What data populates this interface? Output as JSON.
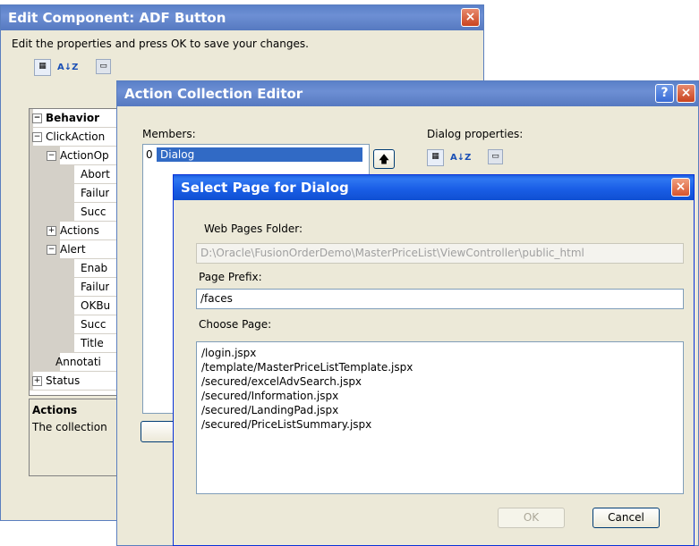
{
  "edit_component": {
    "title": "Edit Component: ADF Button",
    "instruction": "Edit the properties and press OK to save your changes.",
    "grid_rows": [
      {
        "label": "Behavior",
        "sign": "⊟",
        "indent": 0,
        "bold": true
      },
      {
        "label": "ClickAction",
        "sign": "⊟",
        "indent": 0,
        "bold": false
      },
      {
        "label": "ActionOp",
        "sign": "⊟",
        "indent": 1,
        "bold": false
      },
      {
        "label": "Abort",
        "sign": "",
        "indent": 2,
        "bold": false
      },
      {
        "label": "Failur",
        "sign": "",
        "indent": 2,
        "bold": false
      },
      {
        "label": "Succ",
        "sign": "",
        "indent": 2,
        "bold": false
      },
      {
        "label": "Actions",
        "sign": "⊞",
        "indent": 1,
        "bold": false
      },
      {
        "label": "Alert",
        "sign": "⊟",
        "indent": 1,
        "bold": false
      },
      {
        "label": "Enab",
        "sign": "",
        "indent": 2,
        "bold": false
      },
      {
        "label": "Failur",
        "sign": "",
        "indent": 2,
        "bold": false
      },
      {
        "label": "OKBu",
        "sign": "",
        "indent": 2,
        "bold": false
      },
      {
        "label": "Succ",
        "sign": "",
        "indent": 2,
        "bold": false
      },
      {
        "label": "Title",
        "sign": "",
        "indent": 2,
        "bold": false
      },
      {
        "label": "Annotati",
        "sign": "",
        "indent": 1,
        "bold": false
      },
      {
        "label": "Status",
        "sign": "⊞",
        "indent": 0,
        "bold": false
      }
    ],
    "desc_title": "Actions",
    "desc_text": "The collection"
  },
  "action_editor": {
    "title": "Action Collection Editor",
    "members_label": "Members:",
    "member_index": "0",
    "member_name": "Dialog",
    "dialog_props_label": "Dialog properties:"
  },
  "select_page": {
    "title": "Select Page for Dialog",
    "folder_label": "Web Pages Folder:",
    "folder_value": "D:\\Oracle\\FusionOrderDemo\\MasterPriceList\\ViewController\\public_html",
    "prefix_label": "Page Prefix:",
    "prefix_value": "/faces",
    "choose_label": "Choose Page:",
    "pages": [
      "/login.jspx",
      "/template/MasterPriceListTemplate.jspx",
      "/secured/excelAdvSearch.jspx",
      "/secured/Information.jspx",
      "/secured/LandingPad.jspx",
      "/secured/PriceListSummary.jspx"
    ],
    "ok_label": "OK",
    "cancel_label": "Cancel"
  },
  "icons": {
    "close": "×",
    "help": "?",
    "up_arrow": "🡅",
    "sort_az": "A↓Z"
  }
}
